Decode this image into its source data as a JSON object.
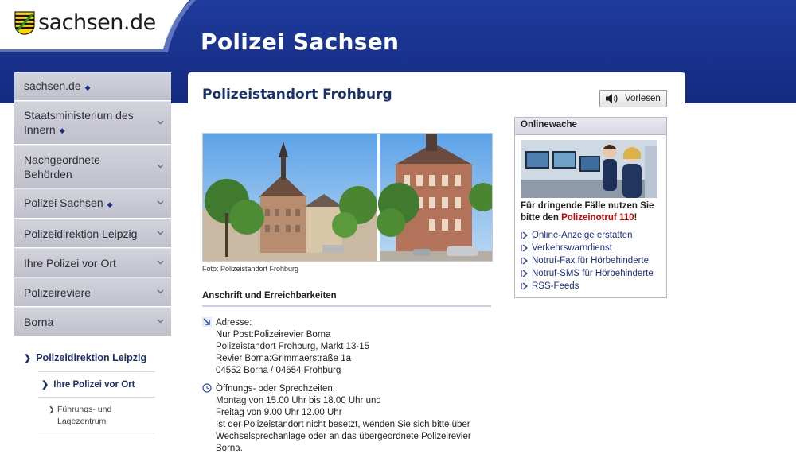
{
  "header": {
    "logo_text": "sachsen.de",
    "site_title": "Polizei Sachsen"
  },
  "sidebar": {
    "items": [
      {
        "label": "sachsen.de",
        "dot": "◆",
        "chevron": false
      },
      {
        "label": "Staatsministerium des Innern",
        "dot": "◆",
        "chevron": true
      },
      {
        "label": "Nachgeordnete Behörden",
        "dot": "",
        "chevron": true
      },
      {
        "label": "Polizei Sachsen",
        "dot": "◆",
        "chevron": true
      },
      {
        "label": "Polizeidirektion Leipzig",
        "dot": "",
        "chevron": true
      },
      {
        "label": "Ihre Polizei vor Ort",
        "dot": "",
        "chevron": true
      },
      {
        "label": "Polizeireviere",
        "dot": "",
        "chevron": true
      },
      {
        "label": "Borna",
        "dot": "",
        "chevron": true
      }
    ],
    "sub_level1": {
      "arrow": "❯",
      "label": "Polizeidirektion Leipzig"
    },
    "sub_level2": {
      "arrow": "❯",
      "label": "Ihre Polizei vor Ort"
    },
    "sub_level3": {
      "arrow": "❯",
      "label_line1": "Führungs- und",
      "label_line2": "Lagezentrum"
    }
  },
  "main": {
    "title": "Polizeistandort Frohburg",
    "read_button": "Vorlesen",
    "photo_caption": "Foto: Polizeistandort Frohburg",
    "section_heading": "Anschrift und Erreichbarkeiten",
    "address": {
      "label": "Adresse:",
      "lines": [
        "Nur Post:Polizeirevier Borna",
        "Polizeistandort Frohburg, Markt 13-15",
        "Revier Borna:Grimmaerstraße 1a",
        "04552 Borna / 04654 Frohburg"
      ]
    },
    "hours": {
      "label": "Öffnungs- oder Sprechzeiten:",
      "lines": [
        "Montag von 15.00 Uhr bis 18.00 Uhr und",
        "Freitag von 9.00 Uhr 12.00 Uhr",
        "Ist der Polizeistandort nicht besetzt, wenden Sie sich bitte über",
        "Wechselsprechanlage oder an das übergeordnete Polizeirevier",
        "Borna."
      ]
    }
  },
  "onlinewache": {
    "heading": "Onlinewache",
    "urgent_text_1": "Für dringende Fälle nutzen Sie",
    "urgent_text_2": "bitte den ",
    "urgent_highlight": "Polizeinotruf 110",
    "urgent_end": "!",
    "links": [
      "Online-Anzeige erstatten",
      "Verkehrswarndienst",
      "Notruf-Fax für Hörbehinderte",
      "Notruf-SMS für Hörbehinderte",
      "RSS-Feeds"
    ]
  },
  "colors": {
    "header_blue": "#1a2f8a",
    "link_blue": "#1a2f8a",
    "emergency_red": "#cc0000",
    "nav_grey": "#c7c7d2"
  }
}
